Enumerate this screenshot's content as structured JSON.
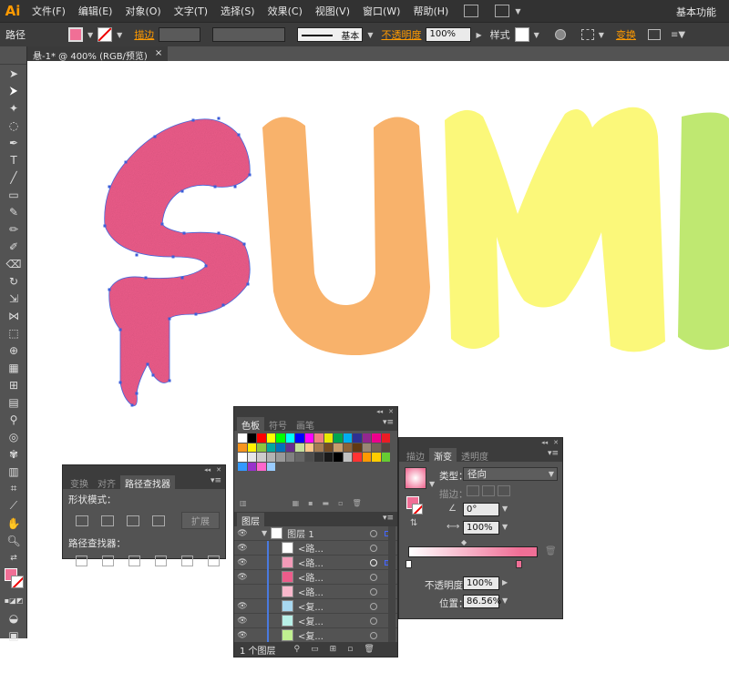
{
  "app": {
    "logo": "Ai",
    "workspace": "基本功能"
  },
  "menu": [
    "文件(F)",
    "编辑(E)",
    "对象(O)",
    "文字(T)",
    "选择(S)",
    "效果(C)",
    "视图(V)",
    "窗口(W)",
    "帮助(H)"
  ],
  "control": {
    "selection_label": "路径",
    "stroke_label": "描边",
    "stroke_style": "基本",
    "opacity_label": "不透明度",
    "opacity_value": "100%",
    "style_label": "样式",
    "transform_label": "变换",
    "fill_color": "#f06f96"
  },
  "document": {
    "tab": "悬-1* @ 400% (RGB/预览)",
    "close": "×"
  },
  "artwork": {
    "letters": [
      "S",
      "U",
      "M",
      "M"
    ],
    "colors": {
      "s": "#ec5c8a",
      "u": "#f8b26b",
      "m1": "#fbf87a",
      "m2": "#bfe871"
    }
  },
  "pathfinder": {
    "tabs": [
      "变换",
      "对齐",
      "路径查找器"
    ],
    "shape_modes": "形状模式：",
    "expand": "扩展",
    "pathfinders": "路径查找器："
  },
  "swatches": {
    "tabs": [
      "色板",
      "符号",
      "画笔"
    ],
    "colors": [
      "#ffffff",
      "#000000",
      "#ff0000",
      "#ffff00",
      "#00ff00",
      "#00ffff",
      "#0000ff",
      "#ff00ff",
      "#f08080",
      "#e8e800",
      "#00a650",
      "#00aeef",
      "#2e3192",
      "#92278f",
      "#ec008c",
      "#ed1c24",
      "#f7941d",
      "#fff200",
      "#8dc63f",
      "#00a99d",
      "#0072bc",
      "#662d91",
      "#c4df9b",
      "#fdc689",
      "#a67c52",
      "#754c24",
      "#c69c6d",
      "#8c6239",
      "#603913",
      "#998675",
      "#736357",
      "#534741",
      "#ffffff",
      "#e6e6e6",
      "#cccccc",
      "#b3b3b3",
      "#999999",
      "#808080",
      "#666666",
      "#4d4d4d",
      "#333333",
      "#1a1a1a",
      "#000000",
      "#c0c0c0",
      "#ff3333",
      "#ff9900",
      "#ffcc00",
      "#66cc33",
      "#3399ff",
      "#9933cc",
      "#ff66cc",
      "#99ccff"
    ]
  },
  "layers": {
    "tab": "图层",
    "root": "图层 1",
    "rows": [
      {
        "name": "<路...",
        "thumb": "#ffffff"
      },
      {
        "name": "<路...",
        "thumb": "#f29bb8"
      },
      {
        "name": "<路...",
        "thumb": "#ec5c8a"
      },
      {
        "name": "<路...",
        "thumb": "#f8b8cc"
      },
      {
        "name": "<复...",
        "thumb": "#a8d8f0"
      },
      {
        "name": "<复...",
        "thumb": "#b8f0e8"
      },
      {
        "name": "<复...",
        "thumb": "#c0f090"
      }
    ],
    "footer": "1 个图层"
  },
  "gradient": {
    "tabs": [
      "描边",
      "渐变",
      "透明度"
    ],
    "type_label": "类型：",
    "type_value": "径向",
    "stroke_label": "描边：",
    "angle_value": "0°",
    "aspect_value": "100%",
    "opacity_label": "不透明度：",
    "opacity_value": "100%",
    "location_label": "位置：",
    "location_value": "86.56%",
    "stop_color": "#f06f96"
  }
}
